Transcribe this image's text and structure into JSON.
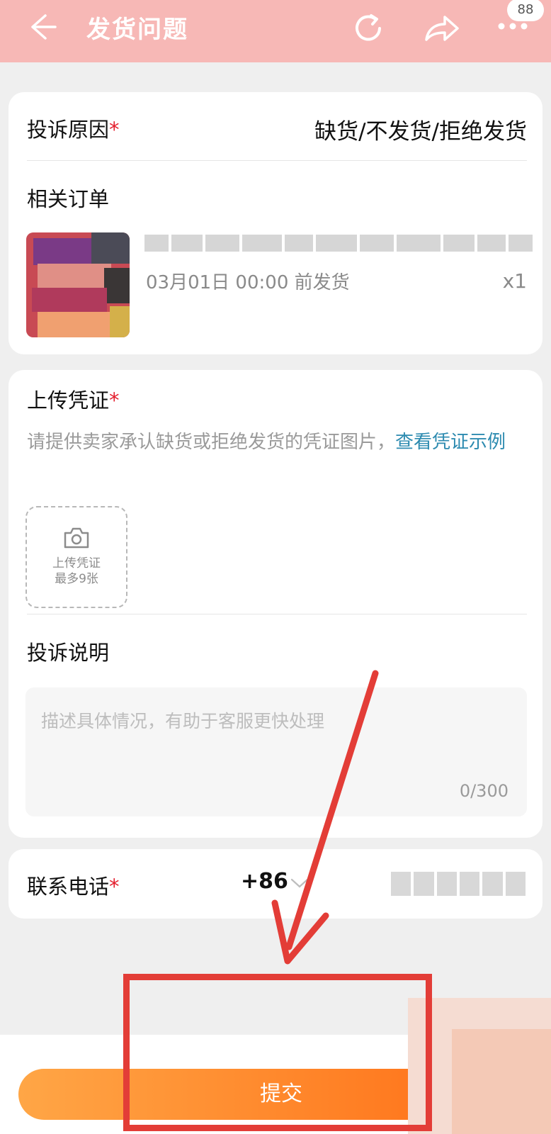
{
  "header": {
    "title": "发货问题",
    "badge": "88",
    "icons": [
      "arrow-left-icon",
      "refresh-icon",
      "share-icon",
      "more-icon"
    ]
  },
  "complaint": {
    "reason_label": "投诉原因",
    "required_mark": "*",
    "reason_value": "缺货/不发货/拒绝发货"
  },
  "order": {
    "section_label": "相关订单",
    "ship_info": "03月01日 00:00 前发货",
    "quantity": "x1"
  },
  "evidence": {
    "label": "上传凭证",
    "required_mark": "*",
    "hint_text": "请提供卖家承认缺货或拒绝发货的凭证图片，",
    "hint_link": "查看凭证示例",
    "upload_line1": "上传凭证",
    "upload_line2": "最多9张"
  },
  "description": {
    "label": "投诉说明",
    "placeholder": "描述具体情况，有助于客服更快处理",
    "count": "0/300"
  },
  "contact": {
    "label": "联系电话",
    "required_mark": "*",
    "country_code": "+86"
  },
  "footer": {
    "submit_label": "提交"
  },
  "colors": {
    "header_bg": "#f7b8b6",
    "accent_orange": "#ff6a12",
    "link_blue": "#2d8bb0",
    "required_red": "#e4202f",
    "annotation_red": "#e33d37"
  }
}
